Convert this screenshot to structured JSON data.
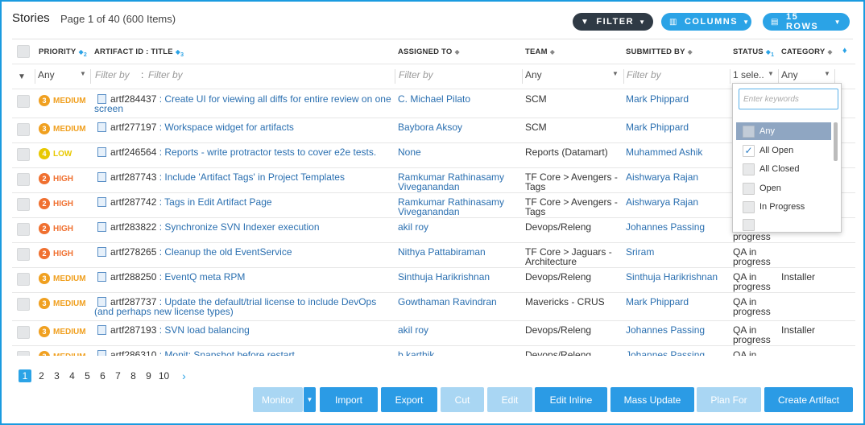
{
  "header": {
    "title": "Stories",
    "subtitle": "Page 1 of 40 (600 Items)",
    "filter_label": "FILTER",
    "columns_label": "COLUMNS",
    "rows_label": "15 ROWS"
  },
  "columns": {
    "priority": "PRIORITY",
    "priority_sub": "2",
    "artifact": "ARTIFACT ID : TITLE",
    "artifact_sub": "3",
    "assigned": "ASSIGNED TO",
    "team": "TEAM",
    "submitted": "SUBMITTED BY",
    "status": "STATUS",
    "status_sub": "1",
    "category": "CATEGORY"
  },
  "filters": {
    "priority": "Any",
    "artifact_a": "Filter by",
    "artifact_b": "Filter by",
    "assigned": "Filter by",
    "team": "Any",
    "submitted": "Filter by",
    "status": "1 sele..",
    "category": "Any"
  },
  "rows": [
    {
      "num": "3",
      "priority": "MEDIUM",
      "color": "#f0a020",
      "id": "artf284437",
      "title": " : Create UI for viewing all diffs for entire review on one",
      "title2": "screen",
      "assigned": "C. Michael Pilato",
      "assigned2": "",
      "team": "SCM",
      "team2": "",
      "submitted": "Mark Phippard",
      "status": "",
      "status2": "",
      "category": ""
    },
    {
      "num": "3",
      "priority": "MEDIUM",
      "color": "#f0a020",
      "id": "artf277197",
      "title": " : Workspace widget for artifacts",
      "title2": "",
      "assigned": "Baybora Aksoy",
      "assigned2": "",
      "team": "SCM",
      "team2": "",
      "submitted": "Mark Phippard",
      "status": "",
      "status2": "",
      "category": ""
    },
    {
      "num": "4",
      "priority": "LOW",
      "color": "#e8c800",
      "id": "artf246564",
      "title": " : Reports - write protractor tests to cover e2e tests.",
      "title2": "",
      "assigned": "None",
      "assigned2": "",
      "team": "Reports (Datamart)",
      "team2": "",
      "submitted": "Muhammed Ashik",
      "status": "",
      "status2": "",
      "category": ""
    },
    {
      "num": "2",
      "priority": "HIGH",
      "color": "#f07030",
      "id": "artf287743",
      "title": " : Include 'Artifact Tags' in Project Templates",
      "title2": "",
      "assigned": "Ramkumar Rathinasamy",
      "assigned2": "Viveganandan",
      "team": "TF Core > Avengers -",
      "team2": "Tags",
      "submitted": "Aishwarya Rajan",
      "status": "",
      "status2": "",
      "category": ""
    },
    {
      "num": "2",
      "priority": "HIGH",
      "color": "#f07030",
      "id": "artf287742",
      "title": " : Tags in Edit Artifact Page",
      "title2": "",
      "assigned": "Ramkumar Rathinasamy",
      "assigned2": "Viveganandan",
      "team": "TF Core > Avengers -",
      "team2": "Tags",
      "submitted": "Aishwarya Rajan",
      "status": "",
      "status2": "",
      "category": ""
    },
    {
      "num": "2",
      "priority": "HIGH",
      "color": "#f07030",
      "id": "artf283822",
      "title": " : Synchronize SVN Indexer execution",
      "title2": "",
      "assigned": "akil roy",
      "assigned2": "",
      "team": "Devops/Releng",
      "team2": "",
      "submitted": "Johannes Passing",
      "status": "",
      "status2": "progress",
      "category": ""
    },
    {
      "num": "2",
      "priority": "HIGH",
      "color": "#f07030",
      "id": "artf278265",
      "title": " : Cleanup the old EventService",
      "title2": "",
      "assigned": "Nithya Pattabiraman",
      "assigned2": "",
      "team": "TF Core > Jaguars -",
      "team2": "Architecture",
      "submitted": "Sriram",
      "status": "QA in",
      "status2": "progress",
      "category": ""
    },
    {
      "num": "3",
      "priority": "MEDIUM",
      "color": "#f0a020",
      "id": "artf288250",
      "title": " : EventQ meta RPM",
      "title2": "",
      "assigned": "Sinthuja Harikrishnan",
      "assigned2": "",
      "team": "Devops/Releng",
      "team2": "",
      "submitted": "Sinthuja Harikrishnan",
      "status": "QA in",
      "status2": "progress",
      "category": "Installer"
    },
    {
      "num": "3",
      "priority": "MEDIUM",
      "color": "#f0a020",
      "id": "artf287737",
      "title": " : Update the default/trial license to include DevOps",
      "title2": "(and perhaps new license types)",
      "assigned": "Gowthaman Ravindran",
      "assigned2": "",
      "team": "Mavericks - CRUS",
      "team2": "",
      "submitted": "Mark Phippard",
      "status": "QA in",
      "status2": "progress",
      "category": ""
    },
    {
      "num": "3",
      "priority": "MEDIUM",
      "color": "#f0a020",
      "id": "artf287193",
      "title": " : SVN load balancing",
      "title2": "",
      "assigned": "akil roy",
      "assigned2": "",
      "team": "Devops/Releng",
      "team2": "",
      "submitted": "Johannes Passing",
      "status": "QA in",
      "status2": "progress",
      "category": "Installer"
    },
    {
      "num": "3",
      "priority": "MEDIUM",
      "color": "#f0a020",
      "id": "artf286310",
      "title": " : Monit: Snapshot before restart",
      "title2": "",
      "assigned": "b.karthik",
      "assigned2": "",
      "team": "Devops/Releng",
      "team2": "",
      "submitted": "Johannes Passing",
      "status": "QA in",
      "status2": "",
      "category": ""
    }
  ],
  "status_dropdown": {
    "placeholder": "Enter keywords",
    "options": [
      {
        "label": "Any",
        "checked": false
      },
      {
        "label": "All Open",
        "checked": true
      },
      {
        "label": "All Closed",
        "checked": false
      },
      {
        "label": "Open",
        "checked": false
      },
      {
        "label": "In Progress",
        "checked": false
      }
    ]
  },
  "pagination": {
    "pages": [
      "1",
      "2",
      "3",
      "4",
      "5",
      "6",
      "7",
      "8",
      "9",
      "10"
    ],
    "current": "1",
    "next": "›"
  },
  "actions": {
    "monitor": "Monitor",
    "import": "Import",
    "export": "Export",
    "cut": "Cut",
    "edit": "Edit",
    "edit_inline": "Edit Inline",
    "mass_update": "Mass Update",
    "plan_for": "Plan For",
    "create_artifact": "Create Artifact"
  },
  "colors": {
    "accent": "#2b9be5",
    "accent_disabled": "#a9d6f3",
    "filter_button": "#2f3a45",
    "medium": "#f0a020",
    "low": "#e8c800",
    "high": "#f07030",
    "link": "#2a6fb0"
  }
}
